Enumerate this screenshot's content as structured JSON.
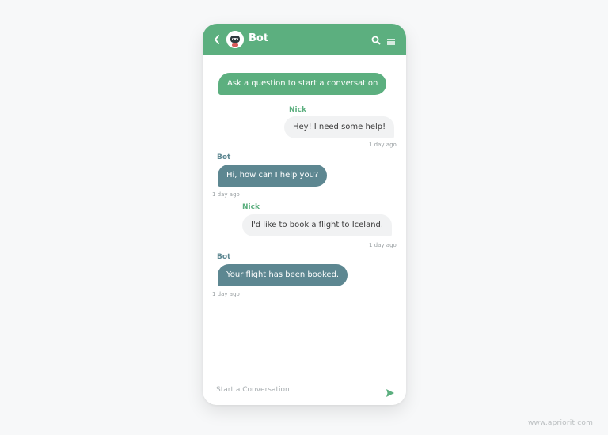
{
  "header": {
    "title": "Bot",
    "back_icon": "chevron-left-icon",
    "avatar_icon": "robot-avatar-icon",
    "search_icon": "search-icon",
    "menu_icon": "hamburger-menu-icon",
    "accent_color": "#5caf7f"
  },
  "messages": [
    {
      "type": "prompt",
      "text": "Ask a question to start a conversation"
    },
    {
      "type": "user",
      "name": "Nick",
      "text": "Hey! I need some help!",
      "time": "1 day ago"
    },
    {
      "type": "bot",
      "name": "Bot",
      "text": "Hi, how can I help you?",
      "time": "1 day ago"
    },
    {
      "type": "user",
      "name": "Nick",
      "text": "I'd like to book a flight to Iceland.",
      "time": "1 day ago"
    },
    {
      "type": "bot",
      "name": "Bot",
      "text": "Your flight has been booked.",
      "time": "1 day ago"
    }
  ],
  "composer": {
    "placeholder": "Start a Conversation",
    "send_icon": "send-icon"
  },
  "watermark": "www.apriorit.com",
  "colors": {
    "bot_bubble": "#5d8791",
    "user_bubble": "#f1f2f3",
    "prompt_bubble": "#5caf7f"
  }
}
